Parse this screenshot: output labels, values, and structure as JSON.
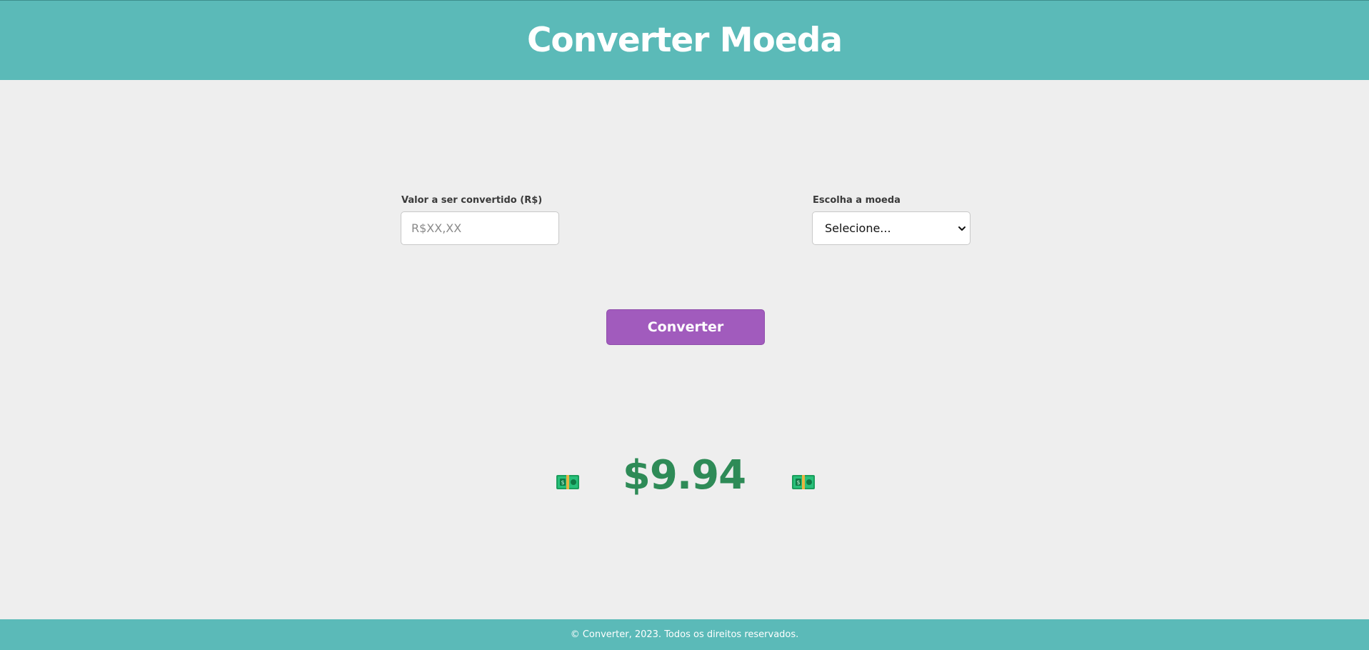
{
  "header": {
    "title": "Converter Moeda"
  },
  "form": {
    "amount_label": "Valor a ser convertido (R$)",
    "amount_placeholder": "R$XX,XX",
    "amount_value": "",
    "currency_label": "Escolha a moeda",
    "currency_selected": "Selecione...",
    "convert_label": "Converter"
  },
  "result": {
    "value": "$9.94",
    "icon_left": "money-bill-icon",
    "icon_right": "money-bill-icon"
  },
  "footer": {
    "text": "© Converter, 2023. Todos os direitos reservados."
  },
  "colors": {
    "header_bg": "#5bbab8",
    "page_bg": "#eeeeee",
    "button_bg": "#a15bbd",
    "result_text": "#2e8b57"
  }
}
